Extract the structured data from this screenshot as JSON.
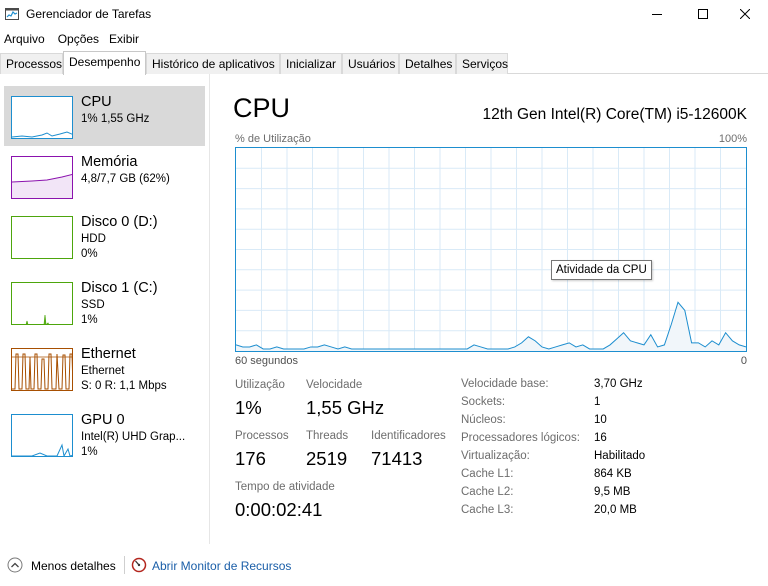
{
  "window": {
    "title": "Gerenciador de Tarefas"
  },
  "menu": [
    "Arquivo",
    "Opções",
    "Exibir"
  ],
  "tabs": [
    {
      "label": "Processos",
      "active": false
    },
    {
      "label": "Desempenho",
      "active": true
    },
    {
      "label": "Histórico de aplicativos",
      "active": false
    },
    {
      "label": "Inicializar",
      "active": false
    },
    {
      "label": "Usuários",
      "active": false
    },
    {
      "label": "Detalhes",
      "active": false
    },
    {
      "label": "Serviços",
      "active": false
    }
  ],
  "sidebar": {
    "items": [
      {
        "title": "CPU",
        "sub1": "1% 1,55 GHz",
        "sub2": "",
        "color": "#1d8ecf",
        "selected": true
      },
      {
        "title": "Memória",
        "sub1": "4,8/7,7 GB (62%)",
        "sub2": "",
        "color": "#8b12ae",
        "selected": false
      },
      {
        "title": "Disco 0 (D:)",
        "sub1": "HDD",
        "sub2": "0%",
        "color": "#4da60c",
        "selected": false
      },
      {
        "title": "Disco 1 (C:)",
        "sub1": "SSD",
        "sub2": "1%",
        "color": "#4da60c",
        "selected": false
      },
      {
        "title": "Ethernet",
        "sub1": "Ethernet",
        "sub2": "S: 0 R: 1,1 Mbps",
        "color": "#a74f01",
        "selected": false
      },
      {
        "title": "GPU 0",
        "sub1": "Intel(R) UHD Grap...",
        "sub2": "1%",
        "color": "#1d8ecf",
        "selected": false
      }
    ]
  },
  "main": {
    "title": "CPU",
    "processor": "12th Gen Intel(R) Core(TM) i5-12600K",
    "graph_label": "% de Utilização",
    "graph_max": "100%",
    "time_left": "60 segundos",
    "time_right": "0",
    "tooltip": "Atividade da CPU",
    "cpu_history_percent": [
      3,
      2,
      2,
      3,
      1,
      1,
      2,
      1,
      1,
      1,
      1,
      2,
      2,
      3,
      2,
      1,
      2,
      1,
      1,
      1,
      1,
      1,
      1,
      1,
      1,
      1,
      1,
      1,
      1,
      1,
      1,
      1,
      1,
      1,
      1,
      3,
      2,
      1,
      1,
      1,
      1,
      2,
      4,
      7,
      5,
      2,
      1,
      2,
      3,
      4,
      2,
      3,
      1,
      1,
      1,
      3,
      6,
      9,
      5,
      4,
      3,
      8,
      2,
      3,
      13,
      24,
      20,
      4,
      4,
      2,
      5,
      3,
      9,
      5,
      3,
      2
    ],
    "stats": {
      "utilizacao_label": "Utilização",
      "utilizacao_value": "1%",
      "velocidade_label": "Velocidade",
      "velocidade_value": "1,55 GHz",
      "processos_label": "Processos",
      "processos_value": "176",
      "threads_label": "Threads",
      "threads_value": "2519",
      "identificadores_label": "Identificadores",
      "identificadores_value": "71413",
      "tempo_label": "Tempo de atividade",
      "tempo_value": "0:00:02:41"
    },
    "specs": [
      {
        "label": "Velocidade base:",
        "value": "3,70 GHz"
      },
      {
        "label": "Sockets:",
        "value": "1"
      },
      {
        "label": "Núcleos:",
        "value": "10"
      },
      {
        "label": "Processadores lógicos:",
        "value": "16"
      },
      {
        "label": "Virtualização:",
        "value": "Habilitado"
      },
      {
        "label": "Cache L1:",
        "value": "864 KB"
      },
      {
        "label": "Cache L2:",
        "value": "9,5 MB"
      },
      {
        "label": "Cache L3:",
        "value": "20,0 MB"
      }
    ]
  },
  "footer": {
    "less_details": "Menos detalhes",
    "resource_monitor": "Abrir Monitor de Recursos"
  }
}
